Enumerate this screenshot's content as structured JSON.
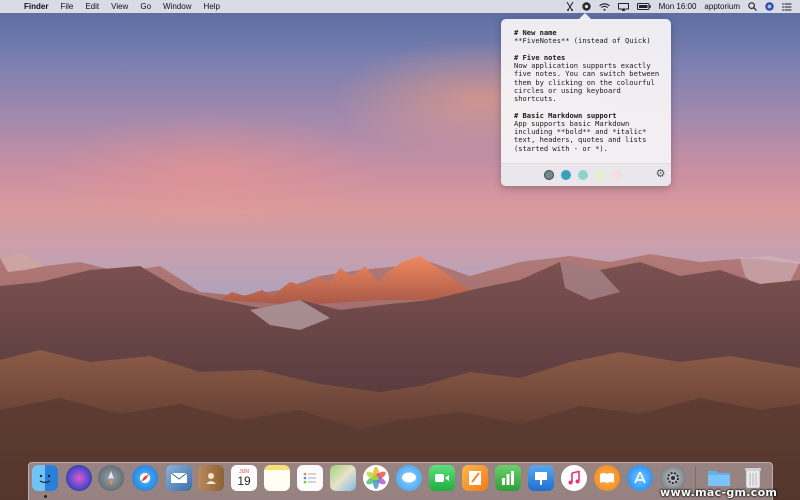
{
  "menubar": {
    "apple_glyph": "",
    "app_name": "Finder",
    "menus": [
      "File",
      "Edit",
      "View",
      "Go",
      "Window",
      "Help"
    ],
    "clock": "Mon 16:00",
    "user": "apptorium"
  },
  "note": {
    "line_1": "# New name",
    "line_2": "**FiveNotes** (instead of Quick)",
    "line_3": "# Five notes",
    "line_4": "Now application supports exactly five notes. You can switch between them by clicking on the colourful circles or using keyboard shortcuts.",
    "line_5": "# Basic Markdown support",
    "line_6": "App supports basic Markdown including **bold** and *italic* text, headers, quotes and lists (started with - or *)."
  },
  "note_colors": [
    "#6d8b8f",
    "#3aa0c0",
    "#8fd4c9",
    "#e4eec6",
    "#f6dede"
  ],
  "dock": {
    "icons": [
      "finder-icon",
      "siri-icon",
      "launchpad-icon",
      "safari-icon",
      "mail-icon",
      "contacts-icon",
      "calendar-icon",
      "notes-icon",
      "reminders-icon",
      "maps-icon",
      "photos-icon",
      "messages-icon",
      "facetime-icon",
      "pages-icon",
      "numbers-icon",
      "keynote-icon",
      "itunes-icon",
      "ibooks-icon",
      "appstore-icon",
      "system-preferences-icon",
      "folder-icon",
      "trash-icon"
    ],
    "calendar_month": "JUN",
    "calendar_day": "19"
  },
  "watermark": "www.mac-gm.com"
}
